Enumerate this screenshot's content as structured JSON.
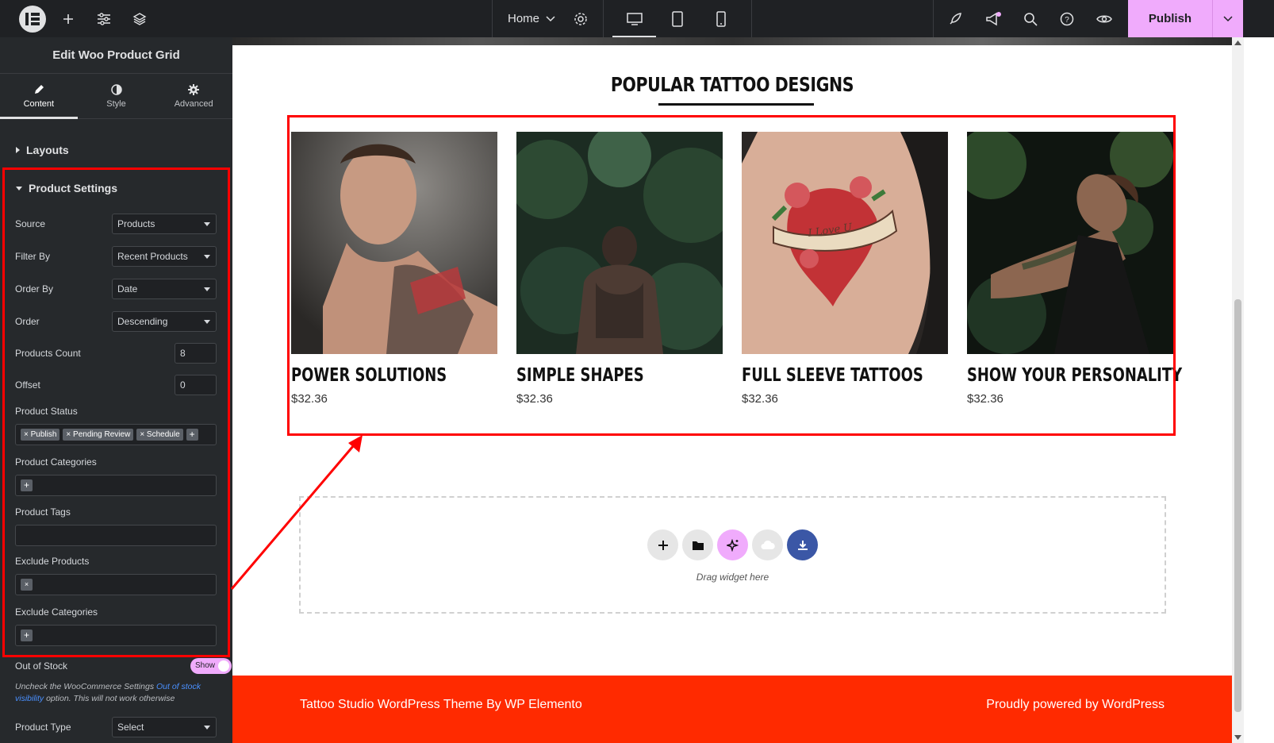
{
  "topbar": {
    "page_name": "Home",
    "publish_label": "Publish",
    "icons": [
      "elementor-logo-icon",
      "add-icon",
      "settings-sliders-icon",
      "layers-icon",
      "chevron-down-icon",
      "gear-icon",
      "desktop-icon",
      "tablet-icon",
      "mobile-icon",
      "rocket-icon",
      "megaphone-icon",
      "search-icon",
      "help-icon",
      "eye-icon"
    ]
  },
  "sidebar": {
    "title": "Edit Woo Product Grid",
    "tabs": [
      {
        "label": "Content",
        "icon": "pencil-icon"
      },
      {
        "label": "Style",
        "icon": "half-circle-icon"
      },
      {
        "label": "Advanced",
        "icon": "gear-icon"
      }
    ],
    "layouts_label": "Layouts",
    "product_settings_label": "Product Settings",
    "fields": {
      "source": {
        "label": "Source",
        "value": "Products"
      },
      "filter_by": {
        "label": "Filter By",
        "value": "Recent Products"
      },
      "order_by": {
        "label": "Order By",
        "value": "Date"
      },
      "order": {
        "label": "Order",
        "value": "Descending"
      },
      "products_count": {
        "label": "Products Count",
        "value": "8"
      },
      "offset": {
        "label": "Offset",
        "value": "0"
      },
      "product_status": {
        "label": "Product Status",
        "chips": [
          "× Publish",
          "× Pending Review",
          "× Schedule"
        ]
      },
      "product_categories": {
        "label": "Product Categories"
      },
      "product_tags": {
        "label": "Product Tags"
      },
      "exclude_products": {
        "label": "Exclude Products"
      },
      "exclude_categories": {
        "label": "Exclude Categories"
      },
      "out_of_stock": {
        "label": "Out of Stock",
        "toggle": "Show"
      },
      "product_type": {
        "label": "Product Type",
        "value": "Select"
      }
    },
    "note_pre": "Uncheck the WooCommerce Settings ",
    "note_link": "Out of stock visibility",
    "note_post": " option. This will not work otherwise"
  },
  "canvas": {
    "section_title": "POPULAR TATTOO DESIGNS",
    "products": [
      {
        "name": "POWER SOLUTIONS",
        "price": "$32.36"
      },
      {
        "name": "SIMPLE SHAPES",
        "price": "$32.36"
      },
      {
        "name": "FULL SLEEVE TATTOOS",
        "price": "$32.36"
      },
      {
        "name": "SHOW YOUR PERSONALITY",
        "price": "$32.36"
      }
    ],
    "drop_text": "Drag widget here",
    "footer_left": "Tattoo Studio WordPress Theme By WP Elemento",
    "footer_right": "Proudly powered by WordPress"
  },
  "colors": {
    "accent_pink": "#f0abfc",
    "annotation_red": "#ff0000",
    "footer_red": "#ff2a00",
    "panel_dark": "#26292c"
  }
}
